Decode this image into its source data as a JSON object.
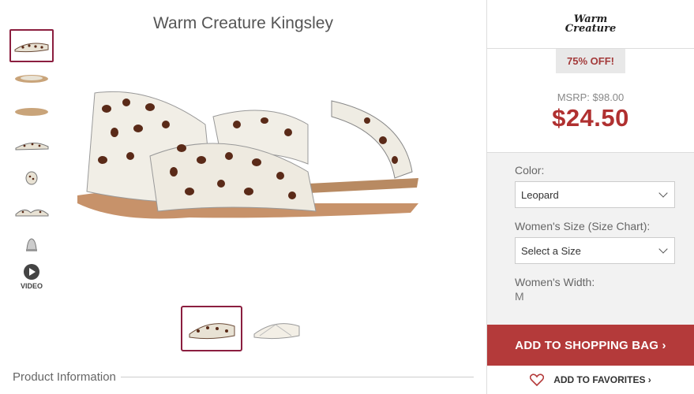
{
  "product": {
    "title": "Warm Creature Kingsley"
  },
  "thumbnails": {
    "video_label": "VIDEO"
  },
  "section": {
    "product_info": "Product Information"
  },
  "panel": {
    "brand_logo_line1": "Warm",
    "brand_logo_line2": "Creature",
    "discount": "75% OFF!",
    "msrp": "MSRP: $98.00",
    "price": "$24.50",
    "color_label": "Color:",
    "color_value": "Leopard",
    "size_label": "Women's Size (Size Chart):",
    "size_value": "Select a Size",
    "width_label": "Women's Width:",
    "width_value": "M",
    "add_to_bag": "ADD TO SHOPPING BAG ›",
    "add_to_favorites": "ADD TO FAVORITES ›"
  },
  "colors": {
    "accent": "#b43a3a",
    "active_border": "#8b1e3f"
  }
}
